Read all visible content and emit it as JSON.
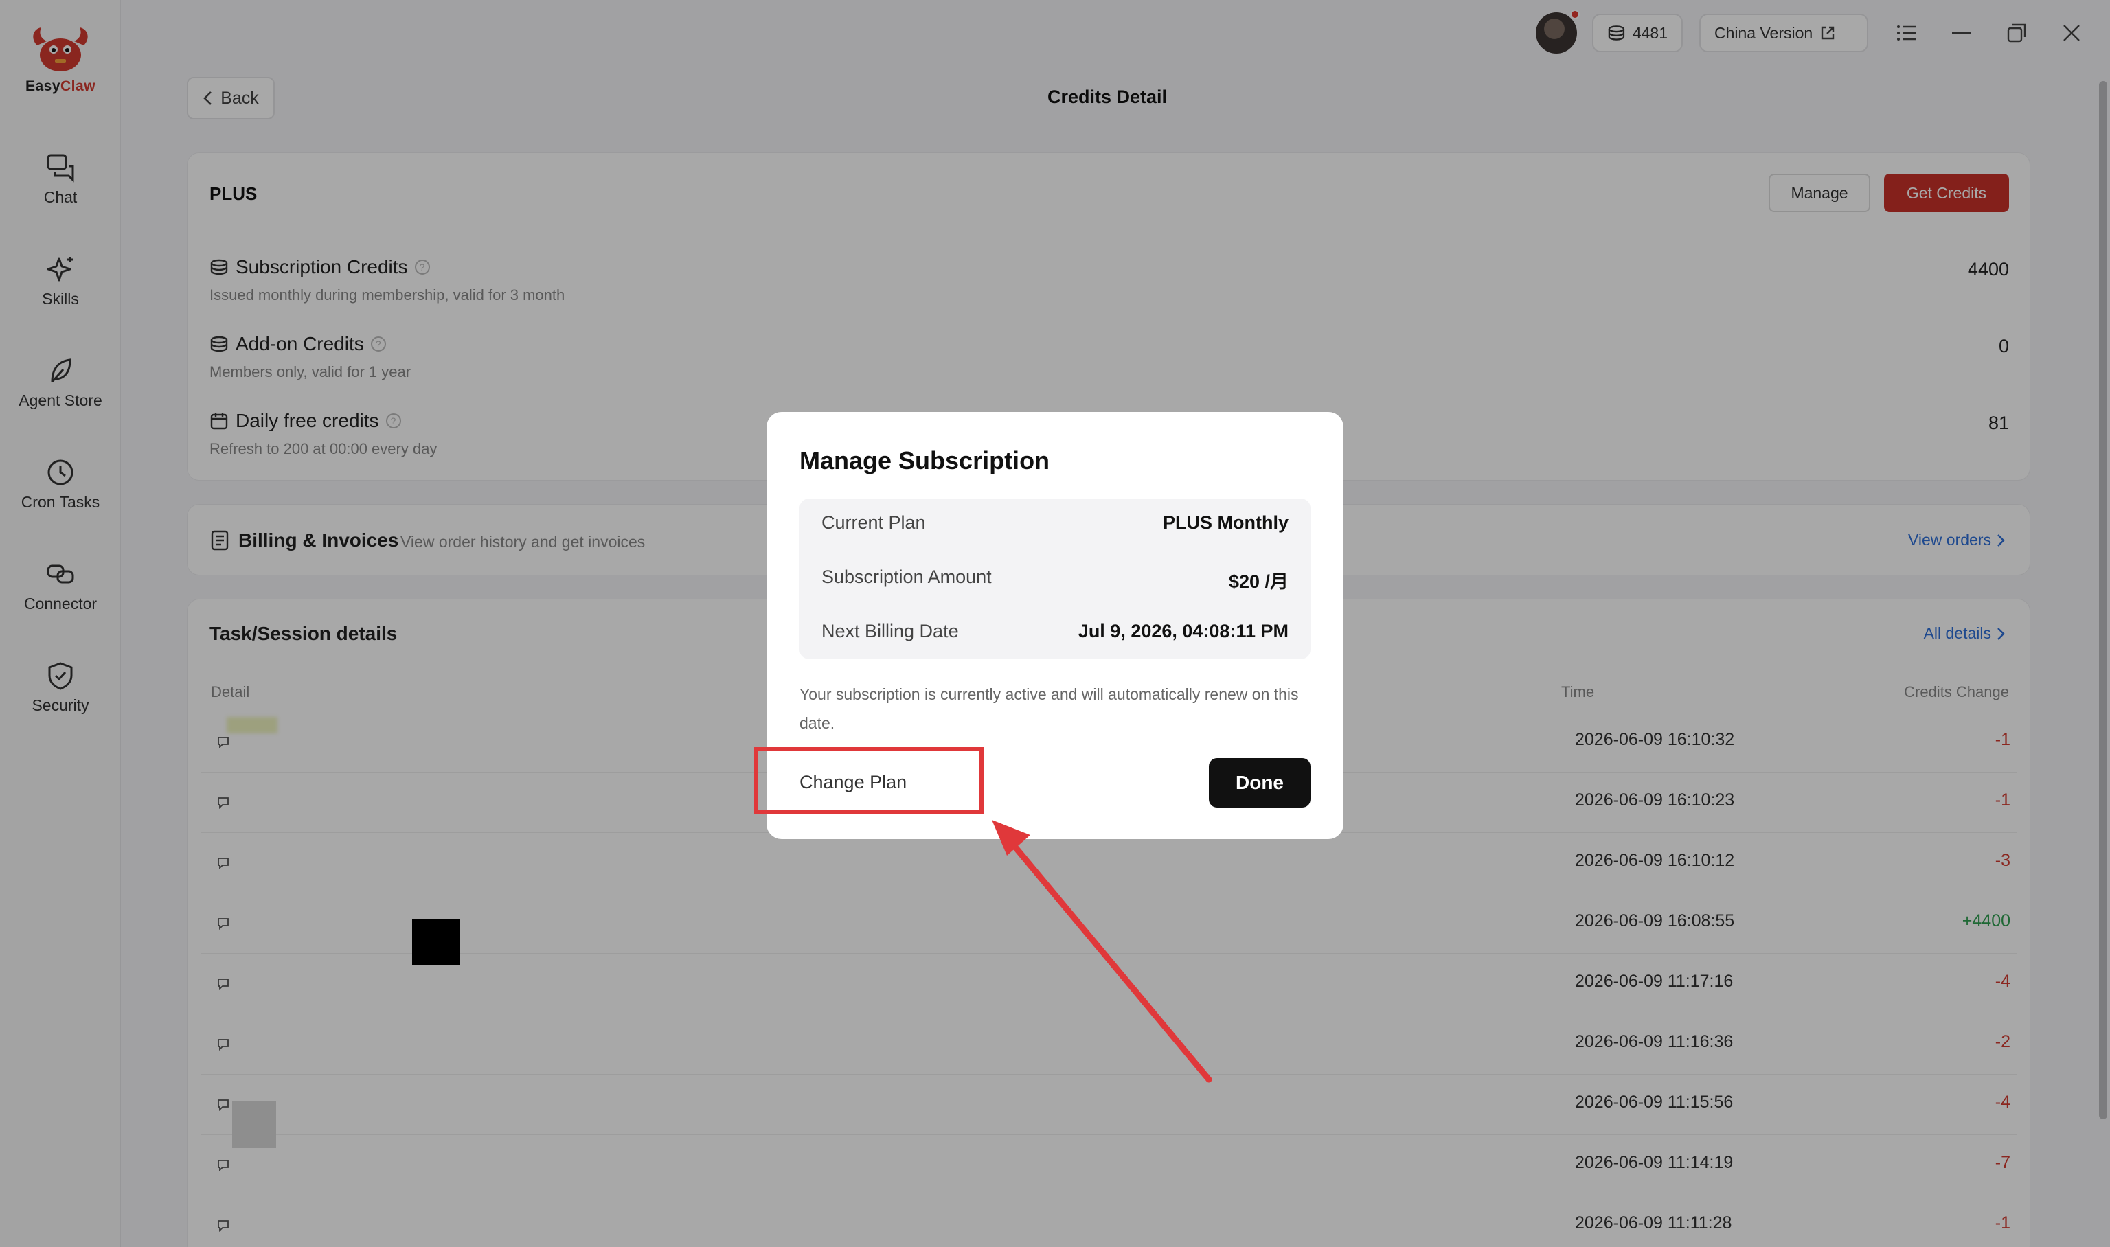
{
  "app": {
    "logo_easy": "Easy",
    "logo_claw": "Claw"
  },
  "sidebar": {
    "items": [
      {
        "label": "Chat",
        "icon": "chat-icon"
      },
      {
        "label": "Skills",
        "icon": "sparkle-icon"
      },
      {
        "label": "Agent Store",
        "icon": "leaf-icon"
      },
      {
        "label": "Cron Tasks",
        "icon": "clock-icon"
      },
      {
        "label": "Connector",
        "icon": "link-icon"
      },
      {
        "label": "Security",
        "icon": "shield-icon"
      }
    ]
  },
  "topbar": {
    "credits": "4481",
    "version_label": "China Version"
  },
  "page": {
    "back_label": "Back",
    "title": "Credits Detail"
  },
  "plan": {
    "name": "PLUS",
    "manage_label": "Manage",
    "get_credits_label": "Get Credits",
    "credits": [
      {
        "title": "Subscription Credits",
        "sub": "Issued monthly during membership, valid for 3 month",
        "value": "4400"
      },
      {
        "title": "Add-on Credits",
        "sub": "Members only, valid for 1 year",
        "value": "0"
      },
      {
        "title": "Daily free credits",
        "sub": "Refresh to 200 at 00:00 every day",
        "value": "81"
      }
    ]
  },
  "billing": {
    "title": "Billing & Invoices",
    "sub": "View order history and get invoices",
    "link": "View orders"
  },
  "tasks": {
    "title": "Task/Session details",
    "link": "All details",
    "headers": {
      "detail": "Detail",
      "time": "Time",
      "change": "Credits Change"
    },
    "rows": [
      {
        "time": "2026-06-09 16:10:32",
        "change": "-1"
      },
      {
        "time": "2026-06-09 16:10:23",
        "change": "-1"
      },
      {
        "time": "2026-06-09 16:10:12",
        "change": "-3"
      },
      {
        "time": "2026-06-09 16:08:55",
        "change": "+4400"
      },
      {
        "time": "2026-06-09 11:17:16",
        "change": "-4"
      },
      {
        "time": "2026-06-09 11:16:36",
        "change": "-2"
      },
      {
        "time": "2026-06-09 11:15:56",
        "change": "-4"
      },
      {
        "time": "2026-06-09 11:14:19",
        "change": "-7"
      },
      {
        "time": "2026-06-09 11:11:28",
        "change": "-1"
      }
    ]
  },
  "modal": {
    "title": "Manage Subscription",
    "rows": [
      {
        "label": "Current Plan",
        "value": "PLUS Monthly"
      },
      {
        "label": "Subscription Amount",
        "value": "$20 /月"
      },
      {
        "label": "Next Billing Date",
        "value": "Jul 9, 2026, 04:08:11 PM"
      }
    ],
    "note": "Your subscription is currently active and will automatically renew on this date.",
    "change_plan_label": "Change Plan",
    "done_label": "Done"
  },
  "colors": {
    "accent": "#c9312a",
    "link": "#2e6fd8",
    "positive": "#2e9e4f",
    "negative": "#d23a2f",
    "annotation": "#e0383a"
  }
}
